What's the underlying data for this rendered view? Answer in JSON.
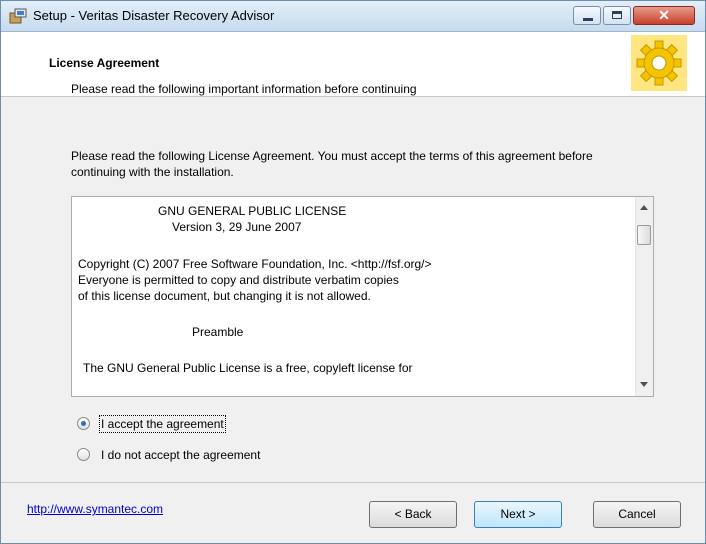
{
  "window": {
    "title": "Setup - Veritas Disaster Recovery Advisor",
    "close_glyph": "✕"
  },
  "header": {
    "title": "License Agreement",
    "subtitle": "Please read the following important information before continuing"
  },
  "intro": "Please read the following License Agreement. You must accept the terms of this agreement before continuing with the installation.",
  "license_text": {
    "line1": "GNU GENERAL PUBLIC LICENSE",
    "line2": "Version 3, 29 June 2007",
    "line3": "Copyright (C) 2007 Free Software Foundation, Inc. <http://fsf.org/>",
    "line4": "Everyone is permitted to copy and distribute verbatim copies",
    "line5": "of this license document, but changing it is not allowed.",
    "line6": "Preamble",
    "line7": "The GNU General Public License is a free, copyleft license for"
  },
  "radios": {
    "accept_label": "I accept the agreement",
    "accept_selected": true,
    "decline_label": "I do not accept the agreement",
    "decline_selected": false
  },
  "footer": {
    "link": "http://www.symantec.com",
    "back": "< Back",
    "next": "Next >",
    "cancel": "Cancel"
  },
  "icons": {
    "app": "setup-box-icon",
    "header": "gear-icon"
  },
  "colors": {
    "gear": "#f5c400",
    "gear_bg": "#ffe680",
    "link": "#0000cc"
  }
}
